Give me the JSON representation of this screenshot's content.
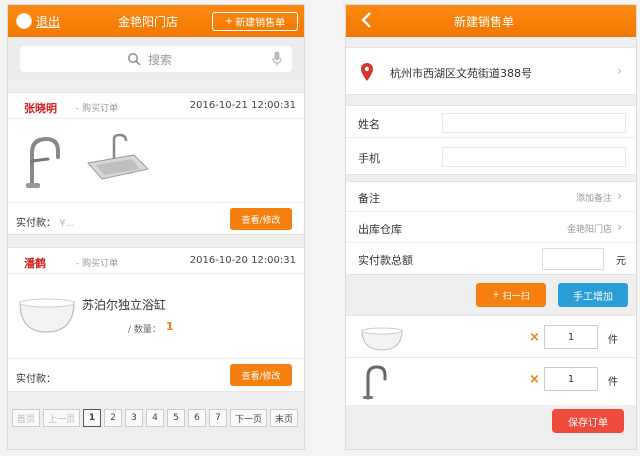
{
  "left": {
    "exit_label": "退出",
    "store_title": "金艳阳门店",
    "new_order_label": "新建销售单",
    "search_placeholder": "搜索",
    "orders": [
      {
        "customer": "张晓明",
        "type": "购买订单",
        "date": "2016-10-21 12:00:31",
        "paid_label": "实付款：",
        "paid_value": "¥...",
        "action_label": "查看/修改",
        "products": [
          "faucet",
          "sink"
        ]
      },
      {
        "customer": "潘鹤",
        "type": "购买订单",
        "date": "2016-10-20 12:00:31",
        "product_name": "苏泊尔独立浴缸",
        "qty_label": "/ 数量：",
        "qty_value": "1",
        "paid_label": "实付款：",
        "action_label": "查看/修改"
      }
    ],
    "pager": [
      "首页",
      "上一页",
      "1",
      "2",
      "3",
      "4",
      "5",
      "6",
      "7",
      "下一页",
      "末页"
    ],
    "pager_active": "1"
  },
  "right": {
    "title": "新建销售单",
    "address": "杭州市西湖区文苑街道388号",
    "name_label": "姓名",
    "phone_label": "手机",
    "note_label": "备注",
    "note_hint": "添加备注",
    "warehouse_label": "出库仓库",
    "warehouse_value": "金艳阳门店",
    "total_label": "实付款总额",
    "total_unit": "元",
    "scan_label": "扫一扫",
    "manual_label": "手工增加",
    "items": [
      {
        "icon": "bathtub",
        "qty": "1",
        "unit": "件"
      },
      {
        "icon": "faucet",
        "qty": "1",
        "unit": "件"
      }
    ],
    "save_label": "保存订单"
  },
  "colors": {
    "accent": "#f57f0f",
    "blue": "#2a9ed8",
    "red": "#ee4b3c",
    "name_red": "#d42020"
  }
}
